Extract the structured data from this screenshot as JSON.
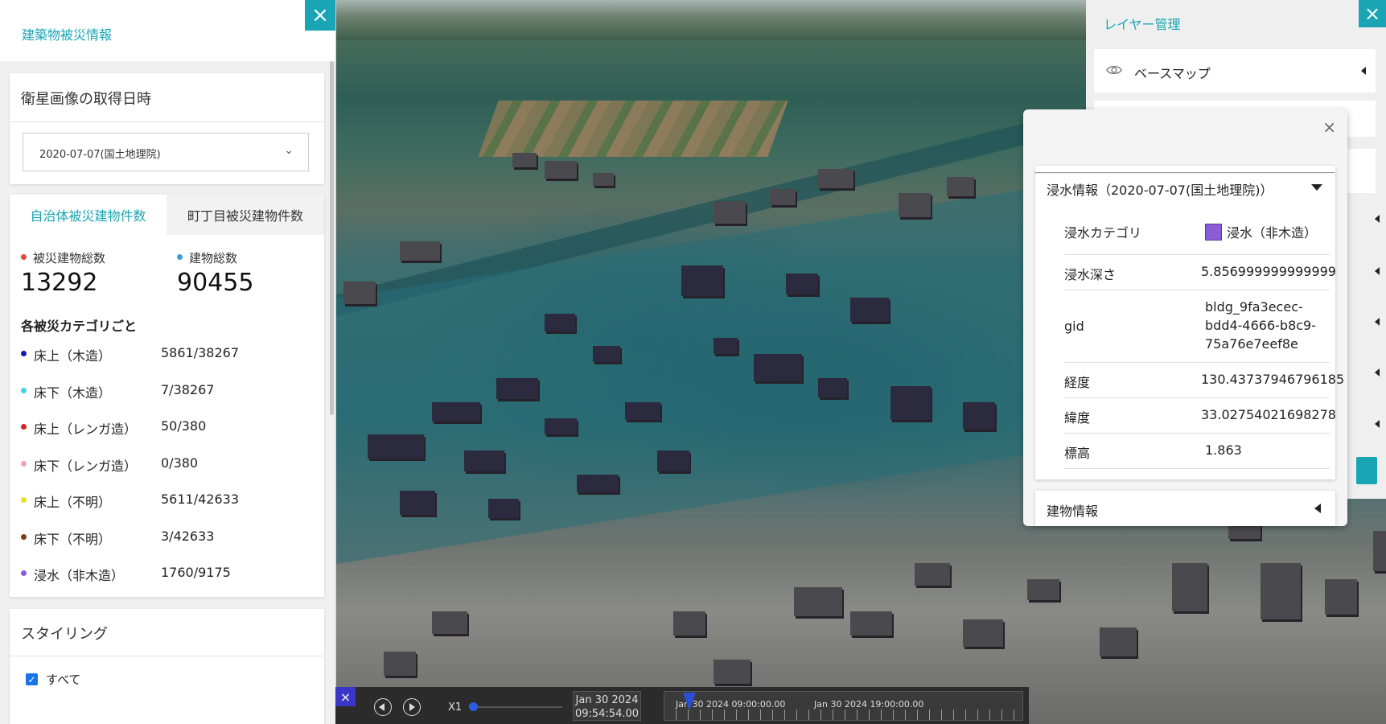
{
  "left_panel": {
    "title": "建築物被災情報",
    "close_icon": "×",
    "satellite": {
      "title": "衛星画像の取得日時",
      "selected": "2020-07-07(国土地理院)",
      "chevron": "⌄"
    },
    "tabs": [
      "自治体被災建物件数",
      "町丁目被災建物件数"
    ],
    "stats": {
      "damaged_label": "被災建物総数",
      "damaged_value": "13292",
      "damaged_color": "#e04b3a",
      "total_label": "建物総数",
      "total_value": "90455",
      "total_color": "#3b9bd9"
    },
    "category_heading": "各被災カテゴリごと",
    "categories": [
      {
        "name": "床上（木造）",
        "value": "5861/38267",
        "color": "#1a1aa8"
      },
      {
        "name": "床下（木造）",
        "value": "7/38267",
        "color": "#3fd3e0"
      },
      {
        "name": "床上（レンガ造）",
        "value": "50/380",
        "color": "#d92020"
      },
      {
        "name": "床下（レンガ造）",
        "value": "0/380",
        "color": "#f0a0c8"
      },
      {
        "name": "床上（不明）",
        "value": "5611/42633",
        "color": "#e8e020"
      },
      {
        "name": "床下（不明）",
        "value": "3/42633",
        "color": "#7a3e18"
      },
      {
        "name": "浸水（非木造）",
        "value": "1760/9175",
        "color": "#8a5cd6"
      }
    ],
    "styling": {
      "title": "スタイリング",
      "all_label": "すべて",
      "all_checked": true
    }
  },
  "layer_panel": {
    "title": "レイヤー管理",
    "close_icon": "×",
    "basemap_label": "ベースマップ",
    "eye_icon": "eye-icon"
  },
  "popup": {
    "close_icon": "×",
    "flood_title": "浸水情報（2020-07-07(国土地理院)）",
    "rows": [
      {
        "key": "浸水カテゴリ",
        "value": "浸水（非木造）"
      },
      {
        "key": "浸水深さ",
        "value": "5.856999999999999"
      },
      {
        "key": "gid",
        "value": "bldg_9fa3ecec-bdd4-4666-b8c9-75a76e7eef8e"
      },
      {
        "key": "経度",
        "value": "130.43737946796185"
      },
      {
        "key": "緯度",
        "value": "33.02754021698278"
      },
      {
        "key": "標高",
        "value": "1.863"
      }
    ],
    "gid_lines": [
      "bldg_9fa3ecec-",
      "bdd4-4666-b8c9-",
      "75a76e7eef8e"
    ],
    "swatch_color": "#8a5cd6",
    "building_title": "建物情報"
  },
  "timeline": {
    "close_icon": "×",
    "speed": "X1",
    "date": "Jan 30 2024",
    "time": "09:54:54.00",
    "label_1": "Jan 30 2024 09:00:00.00",
    "label_2": "Jan 30 2024 19:00:00.00"
  }
}
